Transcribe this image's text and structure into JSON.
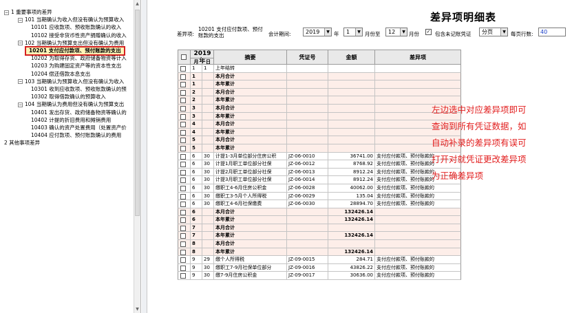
{
  "tree": {
    "items": [
      {
        "label": "1 重要事项的差异",
        "level": 0,
        "exp": "⊟"
      },
      {
        "label": "101 当期确认为收入但没有确认为预算收入",
        "level": 1,
        "exp": "⊟"
      },
      {
        "label": "10101 应收款项、预收账款确认的收入",
        "level": 2,
        "exp": ""
      },
      {
        "label": "10102 接受非货币性资产捐赠确认的收入",
        "level": 2,
        "exp": ""
      },
      {
        "label": "102 当期确认为预算支出但没有确认为费用",
        "level": 1,
        "exp": "⊟"
      },
      {
        "label": "10201 支付应付款项、预付账款的支出",
        "level": 2,
        "exp": "",
        "selected": true
      },
      {
        "label": "10202 为取得存货、政府储备物资等计入",
        "level": 2,
        "exp": ""
      },
      {
        "label": "10203 为购建固定资产等的资本性支出",
        "level": 2,
        "exp": ""
      },
      {
        "label": "10204 偿还借款本息支出",
        "level": 2,
        "exp": ""
      },
      {
        "label": "103 当期确认为预算收入但没有确认为收入",
        "level": 1,
        "exp": "⊟"
      },
      {
        "label": "10301 收到应收款项、预收账款确认的预",
        "level": 2,
        "exp": ""
      },
      {
        "label": "10302 取得借款确认的预算收入",
        "level": 2,
        "exp": ""
      },
      {
        "label": "104 当期确认为费用但没有确认为预算支出",
        "level": 1,
        "exp": "⊟"
      },
      {
        "label": "10401 发出存货、政府储备物资等确认的",
        "level": 2,
        "exp": ""
      },
      {
        "label": "10402 计提的折旧费用和摊销费用",
        "level": 2,
        "exp": ""
      },
      {
        "label": "10403 确认的资产处置费用（处置资产价",
        "level": 2,
        "exp": ""
      },
      {
        "label": "10404 应付款项、预付账款确认的费用",
        "level": 2,
        "exp": ""
      },
      {
        "label": "2 其他事项差异",
        "level": 0,
        "exp": ""
      }
    ]
  },
  "header": {
    "title": "差异项明细表",
    "diff_label": "差异项:",
    "diff_value_line1": "10201 支付应付款项、预付",
    "diff_value_line2": "账款的支出",
    "period_label": "会计期间:",
    "year": "2019",
    "year_unit": "年",
    "month_from": "1",
    "month_to_label": "月份至",
    "month_to": "12",
    "month_unit": "月份",
    "include_unposted_checked": "✓",
    "include_unposted_label": "包含未记账凭证",
    "paging": "分页",
    "rows_per_page_label": "每页行数:",
    "rows_per_page": "40"
  },
  "table": {
    "year_header": "2019年",
    "col_month": "月",
    "col_day": "日",
    "col_summary": "摘要",
    "col_voucher": "凭证号",
    "col_amount": "金额",
    "col_diff": "差异项",
    "rows": [
      {
        "m": "1",
        "d": "1",
        "summary": "上年结转",
        "voucher": "",
        "amount": "",
        "diff": "",
        "sum": false
      },
      {
        "m": "1",
        "d": "",
        "summary": "本月合计",
        "voucher": "",
        "amount": "",
        "diff": "",
        "sum": true
      },
      {
        "m": "1",
        "d": "",
        "summary": "本年累计",
        "voucher": "",
        "amount": "",
        "diff": "",
        "sum": true
      },
      {
        "m": "2",
        "d": "",
        "summary": "本月合计",
        "voucher": "",
        "amount": "",
        "diff": "",
        "sum": true
      },
      {
        "m": "2",
        "d": "",
        "summary": "本年累计",
        "voucher": "",
        "amount": "",
        "diff": "",
        "sum": true
      },
      {
        "m": "3",
        "d": "",
        "summary": "本月合计",
        "voucher": "",
        "amount": "",
        "diff": "",
        "sum": true
      },
      {
        "m": "3",
        "d": "",
        "summary": "本年累计",
        "voucher": "",
        "amount": "",
        "diff": "",
        "sum": true
      },
      {
        "m": "4",
        "d": "",
        "summary": "本月合计",
        "voucher": "",
        "amount": "",
        "diff": "",
        "sum": true
      },
      {
        "m": "4",
        "d": "",
        "summary": "本年累计",
        "voucher": "",
        "amount": "",
        "diff": "",
        "sum": true
      },
      {
        "m": "5",
        "d": "",
        "summary": "本月合计",
        "voucher": "",
        "amount": "",
        "diff": "",
        "sum": true
      },
      {
        "m": "5",
        "d": "",
        "summary": "本年累计",
        "voucher": "",
        "amount": "",
        "diff": "",
        "sum": true
      },
      {
        "m": "6",
        "d": "30",
        "summary": "计提1-3月单位部分住房公积",
        "voucher": "JZ-06-0010",
        "amount": "36741.00",
        "diff": "支付应付款项、预付账款的",
        "sum": false
      },
      {
        "m": "6",
        "d": "30",
        "summary": "计提1月职工单位部分社保",
        "voucher": "JZ-06-0012",
        "amount": "8768.92",
        "diff": "支付应付款项、预付账款的",
        "sum": false
      },
      {
        "m": "6",
        "d": "30",
        "summary": "计提2月职工单位部分社保",
        "voucher": "JZ-06-0013",
        "amount": "8912.24",
        "diff": "支付应付款项、预付账款的",
        "sum": false
      },
      {
        "m": "6",
        "d": "30",
        "summary": "计提3月职工单位部分社保",
        "voucher": "JZ-06-0014",
        "amount": "8912.24",
        "diff": "支付应付款项、预付账款的",
        "sum": false
      },
      {
        "m": "6",
        "d": "30",
        "summary": "缴职工4-6月住房公积金",
        "voucher": "JZ-06-0028",
        "amount": "40062.00",
        "diff": "支付应付款项、预付账款的",
        "sum": false
      },
      {
        "m": "6",
        "d": "30",
        "summary": "缴职工3-5月个人所得税",
        "voucher": "JZ-06-0029",
        "amount": "135.04",
        "diff": "支付应付款项、预付账款的",
        "sum": false
      },
      {
        "m": "6",
        "d": "30",
        "summary": "缴职工4-6月社保缴费",
        "voucher": "JZ-06-0030",
        "amount": "28894.70",
        "diff": "支付应付款项、预付账款的",
        "sum": false
      },
      {
        "m": "6",
        "d": "",
        "summary": "本月合计",
        "voucher": "",
        "amount": "132426.14",
        "diff": "",
        "sum": true
      },
      {
        "m": "6",
        "d": "",
        "summary": "本年累计",
        "voucher": "",
        "amount": "132426.14",
        "diff": "",
        "sum": true
      },
      {
        "m": "7",
        "d": "",
        "summary": "本月合计",
        "voucher": "",
        "amount": "",
        "diff": "",
        "sum": true
      },
      {
        "m": "7",
        "d": "",
        "summary": "本年累计",
        "voucher": "",
        "amount": "132426.14",
        "diff": "",
        "sum": true
      },
      {
        "m": "8",
        "d": "",
        "summary": "本月合计",
        "voucher": "",
        "amount": "",
        "diff": "",
        "sum": true
      },
      {
        "m": "8",
        "d": "",
        "summary": "本年累计",
        "voucher": "",
        "amount": "132426.14",
        "diff": "",
        "sum": true
      },
      {
        "m": "9",
        "d": "29",
        "summary": "缴个人所得税",
        "voucher": "JZ-09-0015",
        "amount": "284.71",
        "diff": "支付应付款项、预付账款的",
        "sum": false
      },
      {
        "m": "9",
        "d": "30",
        "summary": "缴职工7-9月社保单位部分",
        "voucher": "JZ-09-0016",
        "amount": "43826.22",
        "diff": "支付应付款项、预付账款的",
        "sum": false
      },
      {
        "m": "9",
        "d": "30",
        "summary": "缴7-9月住房公积金",
        "voucher": "JZ-09-0017",
        "amount": "30636.00",
        "diff": "支付应付款项、预付账款的",
        "sum": false
      }
    ]
  },
  "note": {
    "line1": "左边选中对应差异项即可",
    "line2": "查询到所有凭证数据，如",
    "line3": "自动补录的差异项有误可",
    "line4": "打开对就凭证更改差异项",
    "line5": "为正确差异项"
  },
  "colors": {
    "highlight_border": "#d42020",
    "sum_row_bg": "#fdeee9",
    "note_text": "#e22020",
    "input_text": "#1a3ec8"
  }
}
